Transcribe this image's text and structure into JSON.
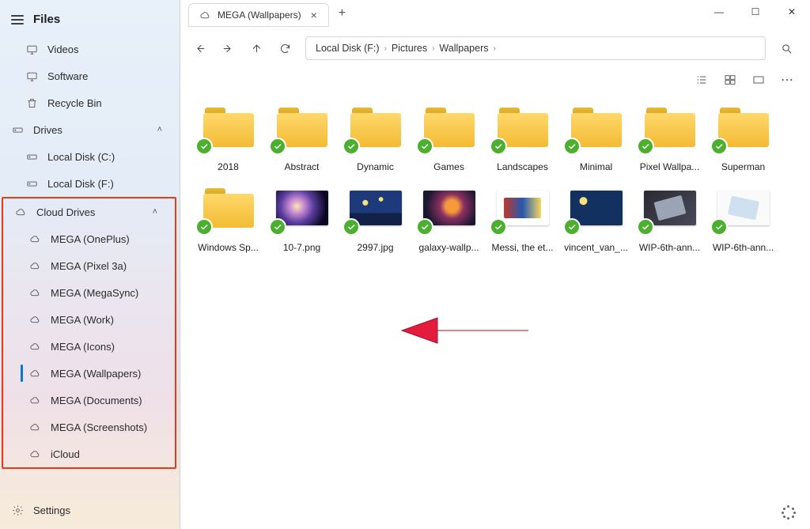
{
  "sidebar": {
    "title": "Files",
    "quick": [
      {
        "label": "Videos",
        "icon": "monitor"
      },
      {
        "label": "Software",
        "icon": "monitor"
      },
      {
        "label": "Recycle Bin",
        "icon": "trash"
      }
    ],
    "drives_label": "Drives",
    "drives": [
      {
        "label": "Local Disk (C:)",
        "icon": "drive"
      },
      {
        "label": "Local Disk (F:)",
        "icon": "drive"
      }
    ],
    "cloud_label": "Cloud Drives",
    "cloud": [
      {
        "label": "MEGA (OnePlus)"
      },
      {
        "label": "MEGA (Pixel 3a)"
      },
      {
        "label": "MEGA (MegaSync)"
      },
      {
        "label": "MEGA (Work)"
      },
      {
        "label": "MEGA (Icons)"
      },
      {
        "label": "MEGA (Wallpapers)",
        "selected": true
      },
      {
        "label": "MEGA (Documents)"
      },
      {
        "label": "MEGA (Screenshots)"
      },
      {
        "label": "iCloud"
      }
    ],
    "settings_label": "Settings"
  },
  "tab": {
    "label": "MEGA (Wallpapers)"
  },
  "breadcrumb": {
    "parts": [
      "Local Disk (F:)",
      "Pictures",
      "Wallpapers"
    ]
  },
  "items": [
    {
      "label": "2018",
      "type": "folder"
    },
    {
      "label": "Abstract",
      "type": "folder"
    },
    {
      "label": "Dynamic",
      "type": "folder"
    },
    {
      "label": "Games",
      "type": "folder"
    },
    {
      "label": "Landscapes",
      "type": "folder"
    },
    {
      "label": "Minimal",
      "type": "folder"
    },
    {
      "label": "Pixel Wallpa...",
      "type": "folder"
    },
    {
      "label": "Superman",
      "type": "folder"
    },
    {
      "label": "Windows Sp...",
      "type": "folder"
    },
    {
      "label": "10-7.png",
      "type": "image",
      "style": "img-galaxy"
    },
    {
      "label": "2997.jpg",
      "type": "image",
      "style": "img-starry"
    },
    {
      "label": "galaxy-wallp...",
      "type": "image",
      "style": "img-neb"
    },
    {
      "label": "Messi, the et...",
      "type": "image",
      "style": "img-messi"
    },
    {
      "label": "vincent_van_...",
      "type": "image",
      "style": "img-vg"
    },
    {
      "label": "WIP-6th-ann...",
      "type": "image",
      "style": "img-wip1"
    },
    {
      "label": "WIP-6th-ann...",
      "type": "image",
      "style": "img-wip2"
    }
  ]
}
